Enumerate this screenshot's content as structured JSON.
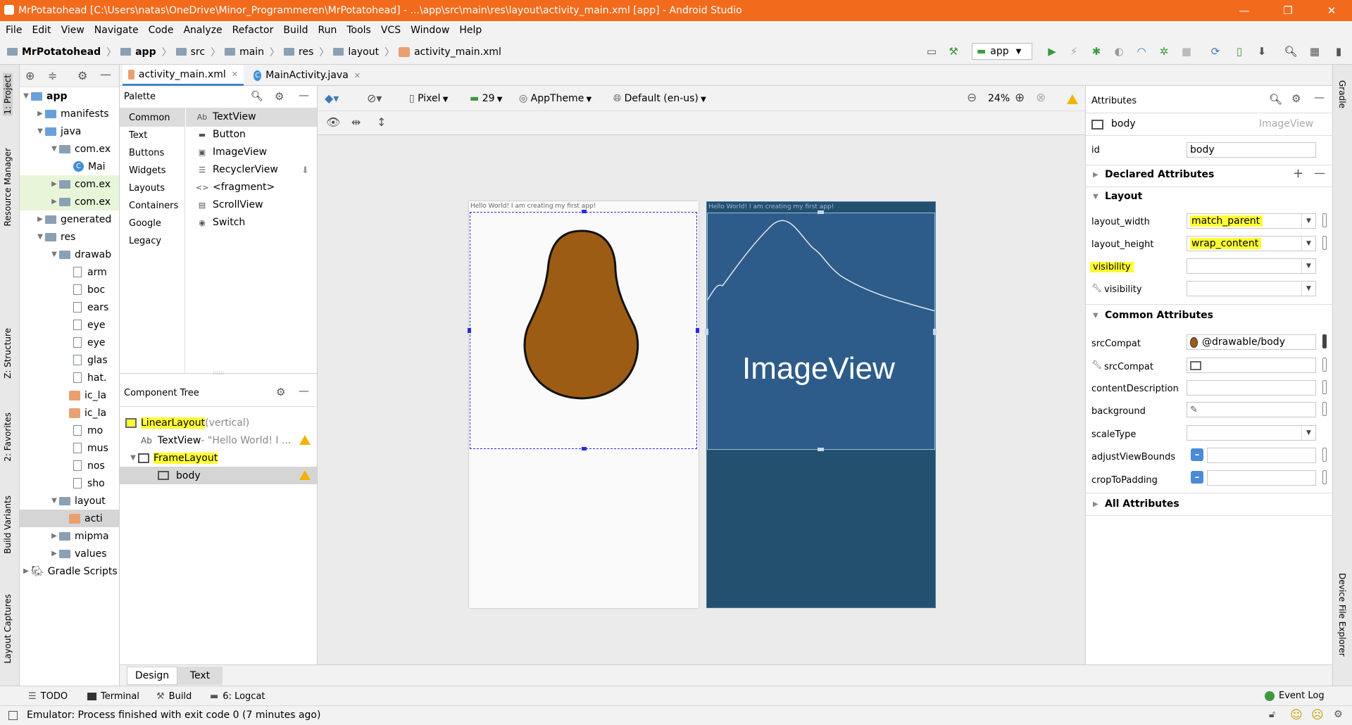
{
  "window": {
    "title": "MrPotatohead [C:\\Users\\natas\\OneDrive\\Minor_Programmeren\\MrPotatohead] - ...\\app\\src\\main\\res\\layout\\activity_main.xml [app] - Android Studio",
    "minimize": "—",
    "maximize": "❐",
    "close": "✕"
  },
  "menu": [
    "File",
    "Edit",
    "View",
    "Navigate",
    "Code",
    "Analyze",
    "Refactor",
    "Build",
    "Run",
    "Tools",
    "VCS",
    "Window",
    "Help"
  ],
  "breadcrumb": [
    "MrPotatohead",
    "app",
    "src",
    "main",
    "res",
    "layout",
    "activity_main.xml"
  ],
  "toolbar": {
    "run_config": "app"
  },
  "left_strip": [
    "1: Project",
    "Resource Manager",
    "Z: Structure",
    "2: Favorites",
    "Build Variants",
    "Layout Captures"
  ],
  "right_strip": [
    "Gradle",
    "Device File Explorer"
  ],
  "project_tree": [
    {
      "label": "app",
      "bold": true,
      "level": 0
    },
    {
      "label": "manifests",
      "level": 1
    },
    {
      "label": "java",
      "level": 1
    },
    {
      "label": "com.ex",
      "level": 2
    },
    {
      "label": "Mai",
      "level": 3
    },
    {
      "label": "com.ex",
      "level": 2
    },
    {
      "label": "com.ex",
      "level": 2
    },
    {
      "label": "generated",
      "level": 1
    },
    {
      "label": "res",
      "level": 1
    },
    {
      "label": "drawab",
      "level": 2
    },
    {
      "label": "arm",
      "level": 3
    },
    {
      "label": "boc",
      "level": 3
    },
    {
      "label": "ears",
      "level": 3
    },
    {
      "label": "eye",
      "level": 3
    },
    {
      "label": "eye",
      "level": 3
    },
    {
      "label": "glas",
      "level": 3
    },
    {
      "label": "hat.",
      "level": 3
    },
    {
      "label": "ic_la",
      "level": 3
    },
    {
      "label": "ic_la",
      "level": 3
    },
    {
      "label": "mo",
      "level": 3
    },
    {
      "label": "mus",
      "level": 3
    },
    {
      "label": "nos",
      "level": 3
    },
    {
      "label": "sho",
      "level": 3
    },
    {
      "label": "layout",
      "level": 2
    },
    {
      "label": "acti",
      "level": 3
    },
    {
      "label": "mipma",
      "level": 2
    },
    {
      "label": "values",
      "level": 2
    },
    {
      "label": "Gradle Scripts",
      "level": 0
    }
  ],
  "editor_tabs": [
    "activity_main.xml",
    "MainActivity.java"
  ],
  "palette": {
    "title": "Palette",
    "categories": [
      "Common",
      "Text",
      "Buttons",
      "Widgets",
      "Layouts",
      "Containers",
      "Google",
      "Legacy"
    ],
    "items": [
      {
        "icon": "Ab",
        "label": "TextView"
      },
      {
        "icon": "▬",
        "label": "Button"
      },
      {
        "icon": "▣",
        "label": "ImageView"
      },
      {
        "icon": "☰",
        "label": "RecyclerView"
      },
      {
        "icon": "<>",
        "label": "<fragment>"
      },
      {
        "icon": "▤",
        "label": "ScrollView"
      },
      {
        "icon": "◉",
        "label": "Switch"
      }
    ]
  },
  "component_tree": {
    "title": "Component Tree",
    "rows": [
      {
        "label": "LinearLayout",
        "suffix": "(vertical)"
      },
      {
        "label": "TextView",
        "suffix": "- \"Hello World! I ..."
      },
      {
        "label": "FrameLayout",
        "suffix": ""
      },
      {
        "label": "body",
        "suffix": ""
      }
    ]
  },
  "design_toolbar": {
    "device": "Pixel",
    "api": "29",
    "theme": "AppTheme",
    "locale": "Default (en-us)",
    "zoom": "24%"
  },
  "preview": {
    "hello_text": "Hello World! I am creating my first app!",
    "blueprint_label": "ImageView"
  },
  "attributes": {
    "title": "Attributes",
    "component_name": "body",
    "component_type": "ImageView",
    "id_label": "id",
    "id_value": "body",
    "sections": {
      "declared": "Declared Attributes",
      "layout": "Layout",
      "common": "Common Attributes",
      "all": "All Attributes"
    },
    "layout_rows": [
      {
        "name": "layout_width",
        "value": "match_parent"
      },
      {
        "name": "layout_height",
        "value": "wrap_content"
      },
      {
        "name": "visibility",
        "value": ""
      },
      {
        "name": "visibility",
        "value": ""
      }
    ],
    "common_rows": [
      {
        "name": "srcCompat",
        "value": "@drawable/body"
      },
      {
        "name": "srcCompat",
        "value": ""
      },
      {
        "name": "contentDescription",
        "value": ""
      },
      {
        "name": "background",
        "value": ""
      },
      {
        "name": "scaleType",
        "value": ""
      },
      {
        "name": "adjustViewBounds",
        "value": ""
      },
      {
        "name": "cropToPadding",
        "value": ""
      }
    ]
  },
  "bottom_tabs": [
    "Design",
    "Text"
  ],
  "tool_windows": [
    "TODO",
    "Terminal",
    "Build",
    "6: Logcat",
    "Event Log"
  ],
  "status": {
    "message": "Emulator: Process finished with exit code 0 (7 minutes ago)"
  },
  "colors": {
    "titlebar": "#f26b1d",
    "highlight": "#ffff33",
    "blueprint": "#2e5c8a",
    "potato": "#9c5c14"
  }
}
